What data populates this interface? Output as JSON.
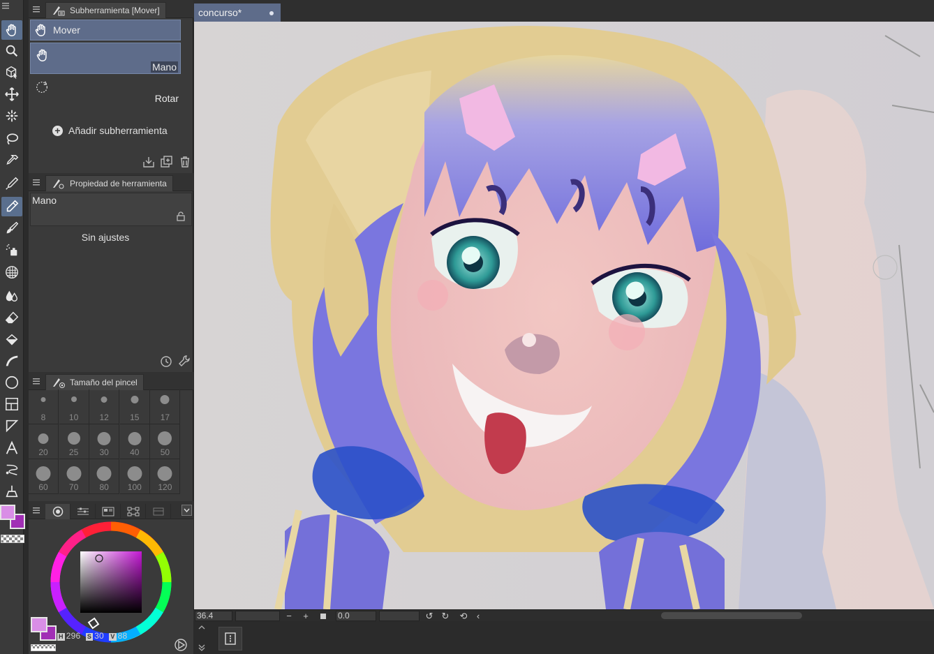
{
  "colors": {
    "accent": "#5e6c8a",
    "main_color": "#d98ee6",
    "sub_color": "#a12fb5"
  },
  "document": {
    "tab_label": "concurso*"
  },
  "subtool_panel": {
    "title": "Subherramienta [Mover]",
    "group_label": "Mover",
    "items": [
      {
        "label": "Mano",
        "icon": "hand-icon",
        "selected": true
      },
      {
        "label": "Rotar",
        "icon": "rotate-icon",
        "selected": false
      }
    ],
    "add_label": "Añadir subherramienta"
  },
  "tool_property_panel": {
    "title": "Propiedad de herramienta",
    "tool_name": "Mano",
    "empty_message": "Sin ajustes"
  },
  "brush_size_panel": {
    "title": "Tamaño del pincel",
    "sizes": [
      "8",
      "10",
      "12",
      "15",
      "17",
      "20",
      "25",
      "30",
      "40",
      "50",
      "60",
      "70",
      "80",
      "100",
      "120"
    ]
  },
  "color_panel": {
    "readout": {
      "h_label": "H",
      "h": "296",
      "s_label": "S",
      "s": "30",
      "v_label": "V",
      "v": "88"
    }
  },
  "toolbar": {
    "tools": [
      "hand-icon",
      "zoom-icon",
      "object-icon",
      "move-layer-icon",
      "auto-select-icon",
      "lasso-icon",
      "eyedropper-icon",
      "pen-icon",
      "pencil-icon",
      "brush-icon",
      "airbrush-icon",
      "decoration-icon",
      "blend-icon",
      "eraser-icon",
      "fill-icon",
      "gradient-icon",
      "figure-icon",
      "frame-icon",
      "ruler-icon",
      "text-icon",
      "balloon-icon",
      "correction-icon"
    ]
  },
  "status_bar": {
    "zoom": "36.4",
    "rotation": "0.0"
  }
}
